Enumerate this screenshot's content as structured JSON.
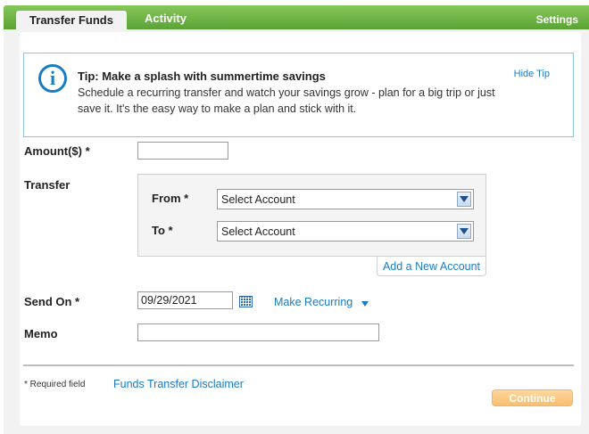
{
  "tabs": {
    "transfer_funds": "Transfer Funds",
    "activity": "Activity",
    "settings": "Settings"
  },
  "tip": {
    "icon": "info-icon",
    "title": "Tip: Make a splash with summertime savings",
    "body": "Schedule a recurring transfer and watch your savings grow - plan for a big trip or just save it. It's the easy way to make a plan and stick with it.",
    "hide_label": "Hide Tip"
  },
  "form": {
    "amount_label": "Amount($) *",
    "amount_value": "",
    "transfer_label": "Transfer",
    "from_label": "From *",
    "from_value": "Select Account",
    "to_label": "To *",
    "to_value": "Select Account",
    "add_account_label": "Add a New Account",
    "send_on_label": "Send On *",
    "send_on_value": "09/29/2021",
    "make_recurring_label": "Make Recurring",
    "memo_label": "Memo",
    "memo_value": ""
  },
  "footer": {
    "required_note": "* Required field",
    "disclaimer_link": "Funds Transfer Disclaimer",
    "continue_label": "Continue"
  },
  "colors": {
    "brand_green": "#6ab43e",
    "link_blue": "#1a7cc1",
    "continue_orange": "#f7bf70"
  }
}
